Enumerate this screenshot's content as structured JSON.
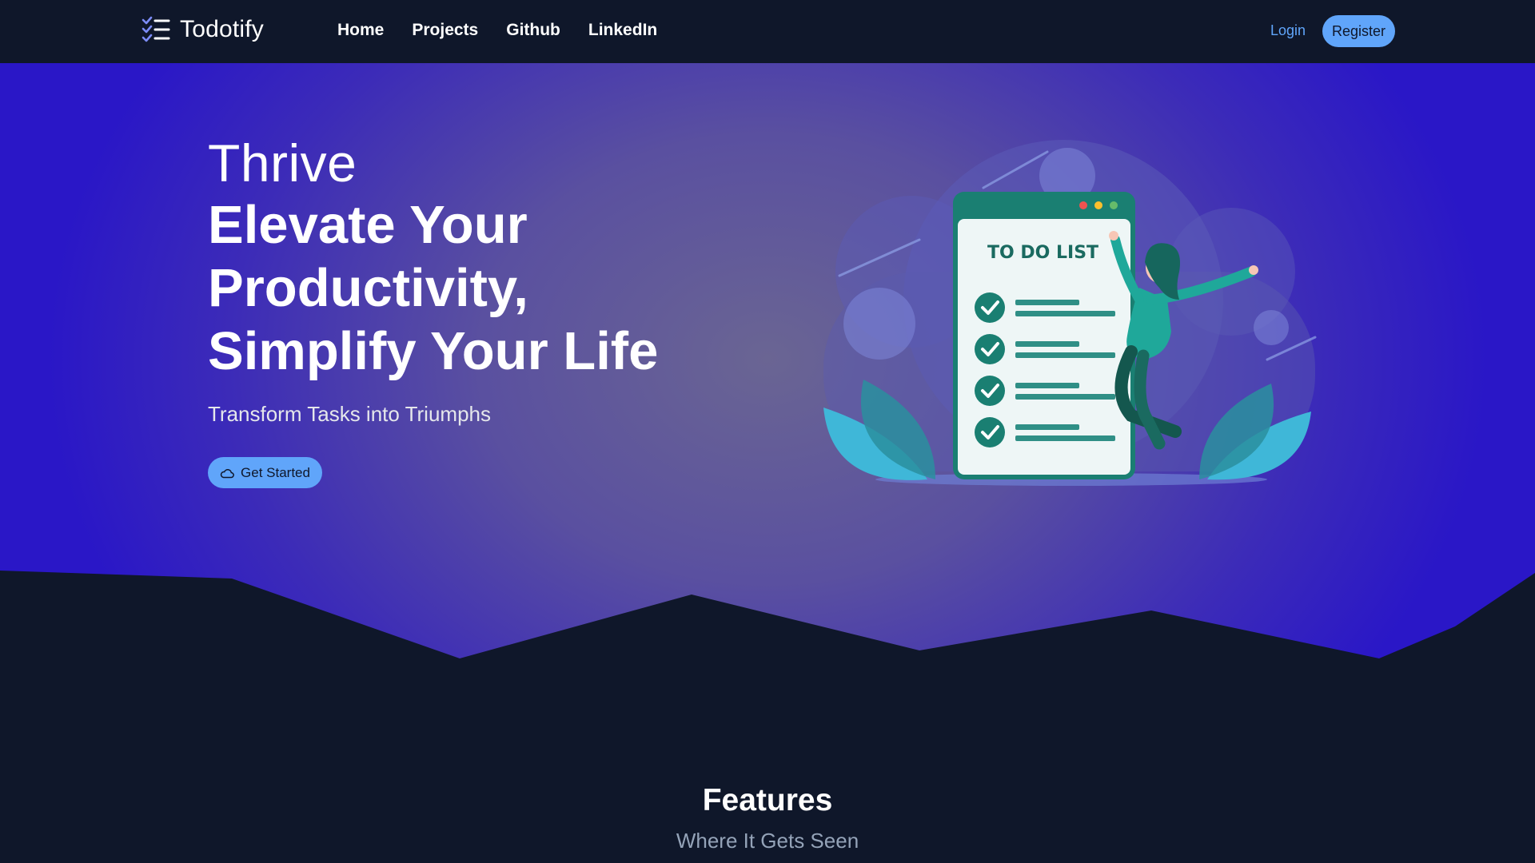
{
  "nav": {
    "brand": "Todotify",
    "links": [
      "Home",
      "Projects",
      "Github",
      "LinkedIn"
    ],
    "login": "Login",
    "register": "Register"
  },
  "hero": {
    "eyebrow": "Thrive",
    "headline": "Elevate Your Productivity, Simplify Your Life",
    "subtitle": "Transform Tasks into Triumphs",
    "cta": "Get Started",
    "illustration_text": "TO DO LIST"
  },
  "features": {
    "title": "Features",
    "subtitle": "Where It Gets Seen"
  },
  "colors": {
    "background": "#0f172a",
    "accent": "#60a5fa",
    "hero_edge": "#2a17c7",
    "teal": "#1a7f72"
  }
}
